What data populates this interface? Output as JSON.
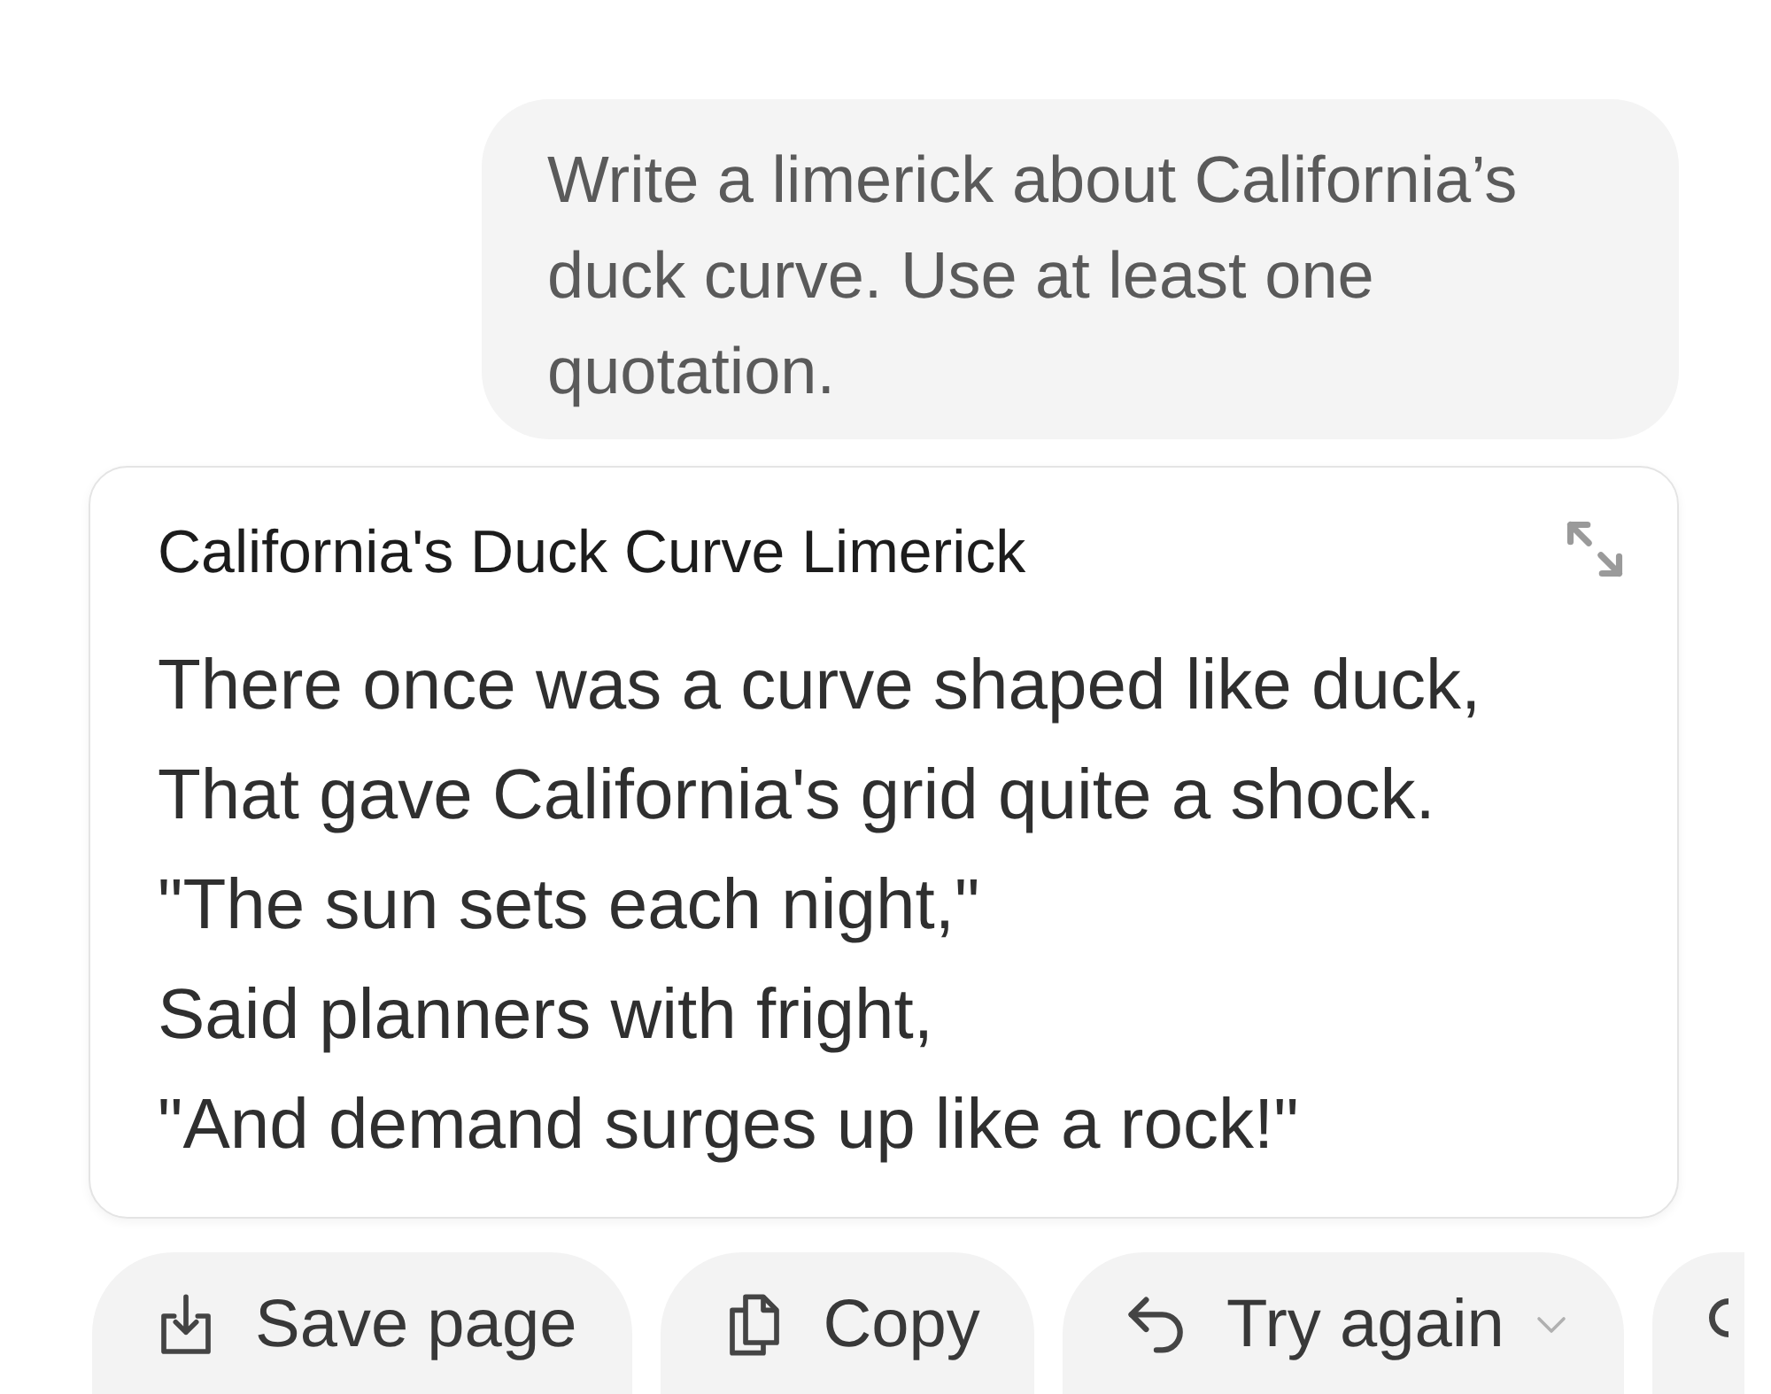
{
  "user_message": {
    "text": "Write a limerick about California’s duck curve. Use at least one quotation."
  },
  "artifact": {
    "title": "California's Duck Curve Limerick",
    "lines": [
      "There once was a curve shaped like duck,",
      "That gave California's grid quite a shock.",
      "\"The sun sets each night,\"",
      "Said planners with fright,",
      "\"And demand surges up like a rock!\""
    ]
  },
  "actions": [
    {
      "kind": "save",
      "label": "Save page",
      "dropdown": false
    },
    {
      "kind": "copy",
      "label": "Copy",
      "dropdown": false
    },
    {
      "kind": "retry",
      "label": "Try again",
      "dropdown": true
    },
    {
      "kind": "partial",
      "dropdown": false
    }
  ]
}
